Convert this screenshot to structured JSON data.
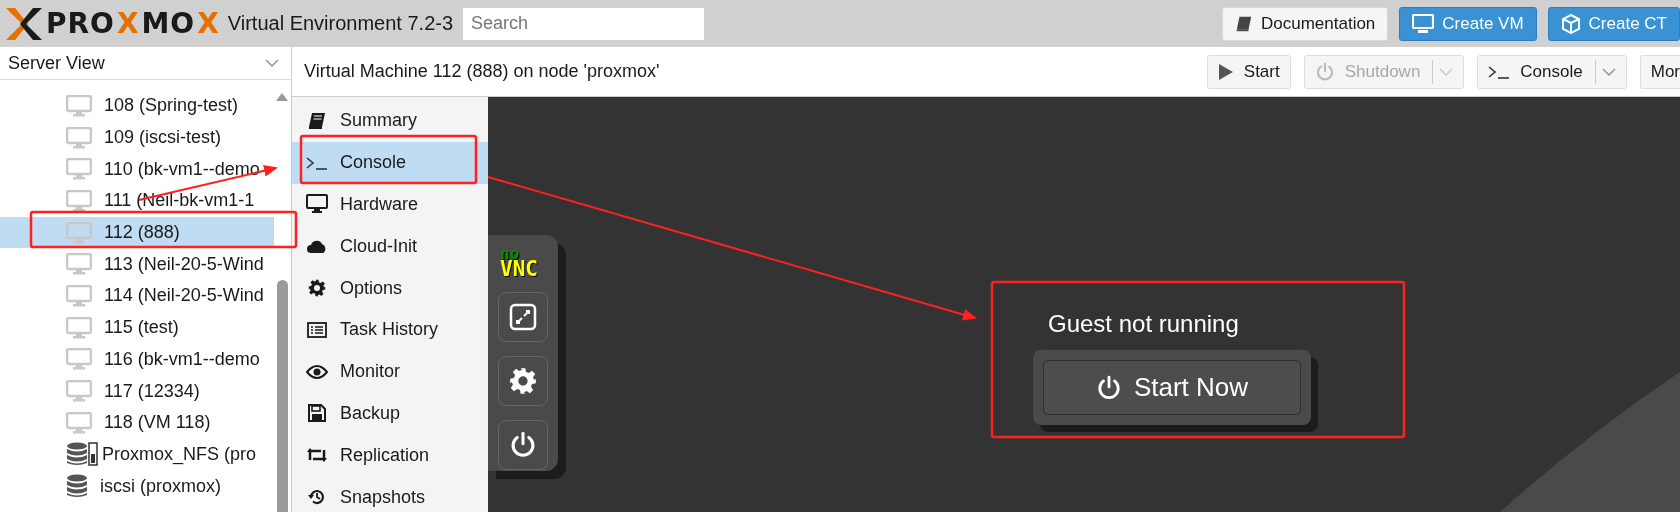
{
  "header": {
    "logo": [
      {
        "text": "PRO",
        "accent": false
      },
      {
        "text": "X",
        "accent": true
      },
      {
        "text": "MO",
        "accent": false
      },
      {
        "text": "X",
        "accent": true
      }
    ],
    "product": "Virtual Environment 7.2-3",
    "search": {
      "placeholder": "Search"
    },
    "buttons": [
      {
        "label": "Documentation",
        "kind": "plain"
      },
      {
        "label": "Create VM",
        "kind": "primary"
      },
      {
        "label": "Create CT",
        "kind": "primary"
      }
    ]
  },
  "sidebar": {
    "view": "Server View",
    "items": [
      {
        "label": "108 (Spring-test)",
        "kind": "vm",
        "selected": false
      },
      {
        "label": "109 (iscsi-test)",
        "kind": "vm",
        "selected": false
      },
      {
        "label": "110 (bk-vm1--demo",
        "kind": "vm",
        "selected": false
      },
      {
        "label": "111 (Neil-bk-vm1-1",
        "kind": "vm",
        "selected": false
      },
      {
        "label": "112 (888)",
        "kind": "vm",
        "selected": true
      },
      {
        "label": "113 (Neil-20-5-Wind",
        "kind": "vm",
        "selected": false
      },
      {
        "label": "114 (Neil-20-5-Wind",
        "kind": "vm",
        "selected": false
      },
      {
        "label": "115 (test)",
        "kind": "vm",
        "selected": false
      },
      {
        "label": "116 (bk-vm1--demo",
        "kind": "vm",
        "selected": false
      },
      {
        "label": "117 (12334)",
        "kind": "vm",
        "selected": false
      },
      {
        "label": "118 (VM 118)",
        "kind": "vm",
        "selected": false
      },
      {
        "label": "Proxmox_NFS (pro",
        "kind": "storage-nfs",
        "selected": false
      },
      {
        "label": "iscsi (proxmox)",
        "kind": "storage",
        "selected": false
      }
    ]
  },
  "content": {
    "title": "Virtual Machine 112 (888) on node 'proxmox'",
    "toolbar": [
      {
        "label": "Start",
        "disabled": false,
        "split": false
      },
      {
        "label": "Shutdown",
        "disabled": true,
        "split": true
      },
      {
        "label": "Console",
        "disabled": false,
        "split": true
      },
      {
        "label": "Mor",
        "disabled": false,
        "split": false
      }
    ],
    "nav": [
      {
        "label": "Summary",
        "selected": false
      },
      {
        "label": "Console",
        "selected": true
      },
      {
        "label": "Hardware",
        "selected": false
      },
      {
        "label": "Cloud-Init",
        "selected": false
      },
      {
        "label": "Options",
        "selected": false
      },
      {
        "label": "Task History",
        "selected": false
      },
      {
        "label": "Monitor",
        "selected": false
      },
      {
        "label": "Backup",
        "selected": false
      },
      {
        "label": "Replication",
        "selected": false
      },
      {
        "label": "Snapshots",
        "selected": false
      }
    ],
    "console": {
      "logo_top": "no",
      "logo_bottom": "VNC",
      "message": "Guest not running",
      "start_button": "Start Now"
    }
  }
}
